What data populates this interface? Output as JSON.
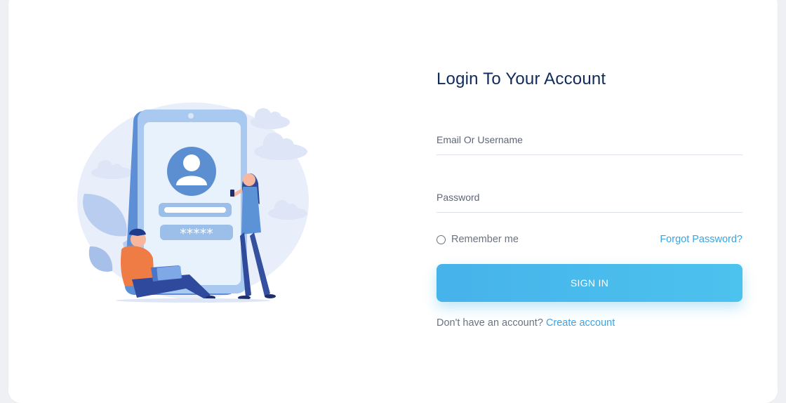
{
  "login": {
    "title": "Login To Your Account",
    "email_placeholder": "Email Or Username",
    "password_placeholder": "Password",
    "remember_label": "Remember me",
    "forgot_label": "Forgot Password?",
    "signin_label": "SIGN IN",
    "no_account_text": "Don't have an account?",
    "create_account_label": "Create account"
  },
  "illustration": {
    "password_mask": "*****"
  },
  "colors": {
    "title": "#0f2b5b",
    "accent": "#3aa3e3",
    "button": "#4cbcee"
  }
}
